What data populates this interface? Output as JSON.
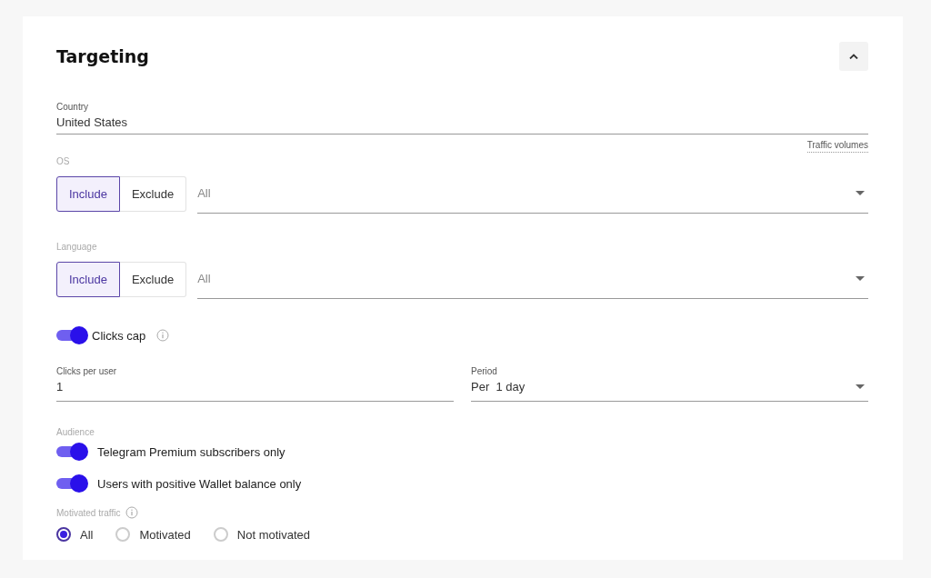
{
  "section": {
    "title": "Targeting",
    "expanded": true
  },
  "country": {
    "label": "Country",
    "value": "United States",
    "link": "Traffic volumes"
  },
  "filters": [
    {
      "label": "OS",
      "modes": [
        {
          "label": "Include",
          "selected": true
        },
        {
          "label": "Exclude",
          "selected": false
        }
      ],
      "placeholder": "All"
    },
    {
      "label": "Language",
      "modes": [
        {
          "label": "Include",
          "selected": true
        },
        {
          "label": "Exclude",
          "selected": false
        }
      ],
      "placeholder": "All"
    }
  ],
  "clicks_cap": {
    "label": "Clicks cap",
    "on": true
  },
  "cap_fields": [
    {
      "kind": "input",
      "label": "Clicks per user",
      "value": "1"
    },
    {
      "kind": "select",
      "label": "Period",
      "value": "Per  1 day"
    }
  ],
  "audience": {
    "label": "Audience",
    "toggles": [
      {
        "label": "Telegram Premium subscribers only",
        "on": true
      },
      {
        "label": "Users with positive Wallet balance only",
        "on": true
      }
    ]
  },
  "motivated": {
    "label": "Motivated traffic",
    "options": [
      {
        "label": "All",
        "selected": true
      },
      {
        "label": "Motivated",
        "selected": false
      },
      {
        "label": "Not motivated",
        "selected": false
      }
    ]
  }
}
